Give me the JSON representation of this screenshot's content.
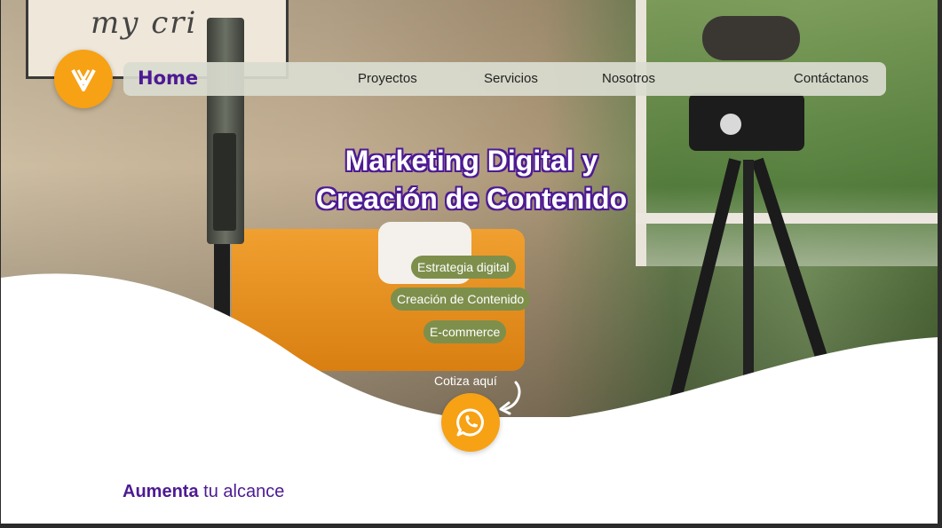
{
  "nav": {
    "home": "Home",
    "links": [
      "Proyectos",
      "Servicios",
      "Nosotros",
      "Contáctanos"
    ]
  },
  "hero": {
    "background_sign_text": "my cri",
    "title_line1": "Marketing Digital y",
    "title_line2": "Creación de Contenido",
    "pills": [
      "Estrategia digital",
      "Creación de Contenido",
      "E-commerce"
    ],
    "cta_label": "Cotiza aquí"
  },
  "section": {
    "title_bold": "Aumenta",
    "title_rest": "tu alcance"
  },
  "icons": {
    "logo": "v-logo-icon",
    "whatsapp": "whatsapp-icon",
    "arrow": "curved-arrow-icon"
  },
  "colors": {
    "brand_purple": "#4d1a93",
    "brand_orange": "#f7a115",
    "pill_green": "#7e8f4c",
    "nav_bg": "#dadcd0"
  }
}
